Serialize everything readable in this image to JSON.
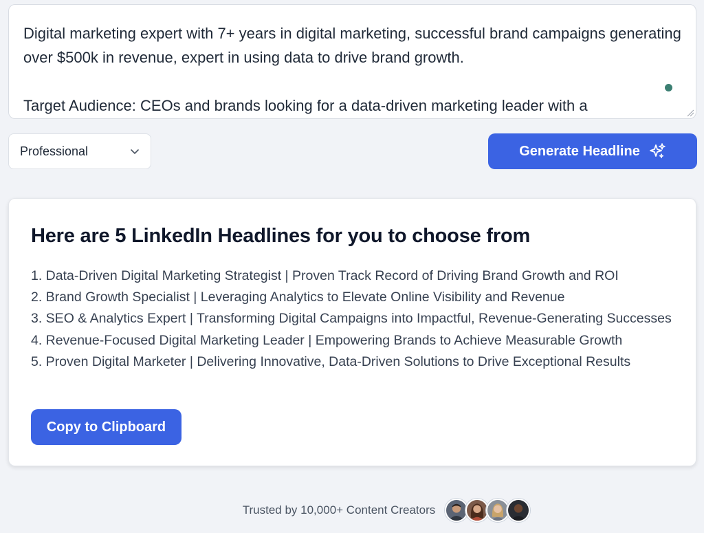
{
  "input": {
    "text": "Digital marketing expert with 7+ years in digital marketing, successful brand campaigns generating over $500k in revenue, expert in using data to drive brand growth.\n\nTarget Audience: CEOs and brands looking for a data-driven marketing leader with a"
  },
  "controls": {
    "tone_selected": "Professional",
    "generate_label": "Generate Headline"
  },
  "results": {
    "title": "Here are 5 LinkedIn Headlines for you to choose from",
    "headlines": [
      "1. Data-Driven Digital Marketing Strategist | Proven Track Record of Driving Brand Growth and ROI",
      "2. Brand Growth Specialist | Leveraging Analytics to Elevate Online Visibility and Revenue",
      "3. SEO & Analytics Expert | Transforming Digital Campaigns into Impactful, Revenue-Generating Successes",
      "4. Revenue-Focused Digital Marketing Leader | Empowering Brands to Achieve Measurable Growth",
      "5. Proven Digital Marketer | Delivering Innovative, Data-Driven Solutions to Drive Exceptional Results"
    ],
    "copy_label": "Copy to Clipboard"
  },
  "footer": {
    "trust_text": "Trusted by 10,000+ Content Creators"
  },
  "colors": {
    "accent": "#3b63e3",
    "status_dot": "#3b7f72",
    "page_bg": "#f1f3f7"
  },
  "icons": {
    "generate": "sparkles-icon",
    "select": "chevron-down-icon",
    "resize": "resize-handle-icon"
  }
}
